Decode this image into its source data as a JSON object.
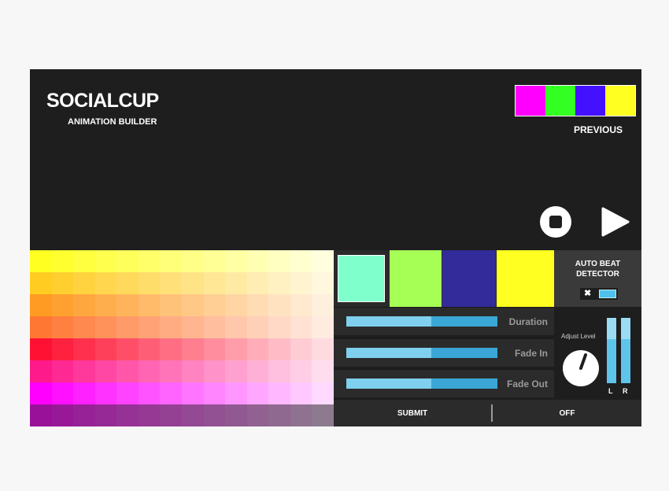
{
  "brand": {
    "title": "SOCIALCUP",
    "subtitle": "ANIMATION BUILDER"
  },
  "previous": {
    "label": "PREVIOUS",
    "swatches": [
      "#ff00ff",
      "#33ff22",
      "#4411ff",
      "#ffff22"
    ]
  },
  "controls": {
    "stop_icon": "stop-icon",
    "play_icon": "play-icon"
  },
  "palette": {
    "base_colors": [
      "#ffff22",
      "#ffcc22",
      "#ff9a22",
      "#ff7733",
      "#ff1133",
      "#ff1a8c",
      "#ff00ff",
      "#991199"
    ],
    "rows": 8,
    "cols": 14
  },
  "selected_colors": [
    "#7fffcc",
    "#a6ff55",
    "#332b99",
    "#ffff22"
  ],
  "sliders": [
    {
      "label": "Duration",
      "value": 0.56
    },
    {
      "label": "Fade In",
      "value": 0.56
    },
    {
      "label": "Fade Out",
      "value": 0.56
    }
  ],
  "actions": {
    "submit_label": "SUBMIT",
    "off_label": "OFF"
  },
  "beat_detector": {
    "title_line1": "AUTO BEAT",
    "title_line2": "DETECTOR",
    "toggle_x": "✖"
  },
  "level": {
    "adjust_label": "Adjust Level",
    "left_label": "L",
    "right_label": "R",
    "left_level": 0.68,
    "right_level": 0.68
  },
  "colors": {
    "accent": "#4ec2ea",
    "panel": "#1e1e1e"
  }
}
